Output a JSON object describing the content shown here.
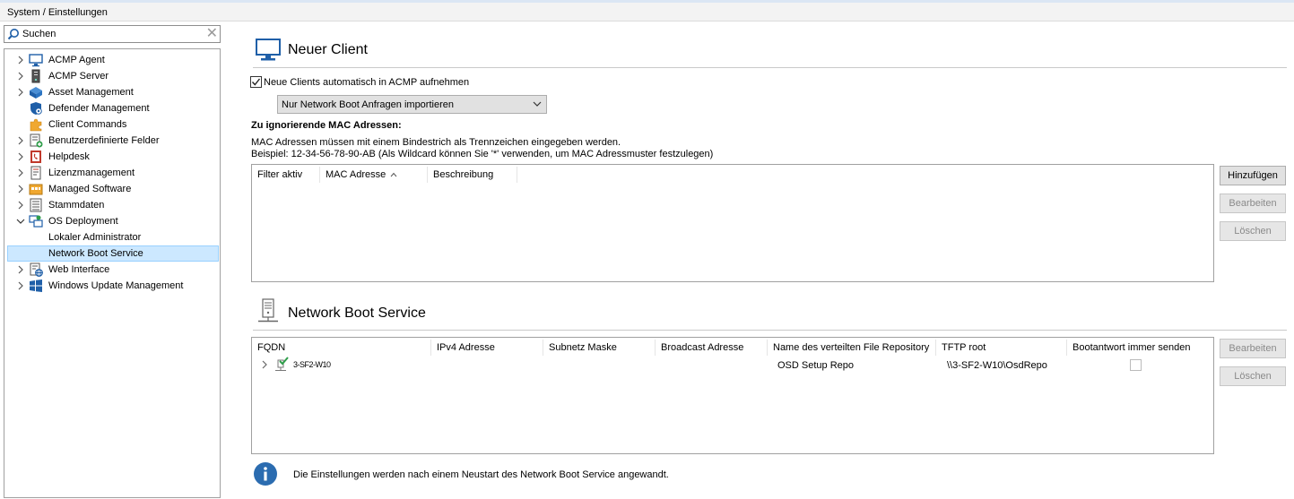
{
  "breadcrumb": "System / Einstellungen",
  "search": {
    "placeholder": "Suchen"
  },
  "tree": {
    "items": [
      {
        "label": "ACMP Agent",
        "icon": "monitor-icon"
      },
      {
        "label": "ACMP Server",
        "icon": "server-icon"
      },
      {
        "label": "Asset Management",
        "icon": "cube-icon"
      },
      {
        "label": "Defender Management",
        "icon": "shield-icon"
      },
      {
        "label": "Client Commands",
        "icon": "puzzle-icon"
      },
      {
        "label": "Benutzerdefinierte Felder",
        "icon": "form-add-icon"
      },
      {
        "label": "Helpdesk",
        "icon": "phone-book-icon"
      },
      {
        "label": "Lizenzmanagement",
        "icon": "license-icon"
      },
      {
        "label": "Managed Software",
        "icon": "software-icon"
      },
      {
        "label": "Stammdaten",
        "icon": "list-icon"
      },
      {
        "label": "OS Deployment",
        "icon": "deployment-icon"
      },
      {
        "label": "Lokaler Administrator",
        "icon": ""
      },
      {
        "label": "Network Boot Service",
        "icon": ""
      },
      {
        "label": "Web Interface",
        "icon": "web-icon"
      },
      {
        "label": "Windows Update Management",
        "icon": "windows-icon"
      }
    ]
  },
  "new_client": {
    "title": "Neuer Client",
    "auto_add_label": "Neue Clients automatisch in ACMP aufnehmen",
    "auto_add_checked": true,
    "import_mode": "Nur Network Boot Anfragen importieren",
    "mac_heading": "Zu ignorierende MAC Adressen:",
    "mac_help_1": "MAC Adressen müssen mit einem Bindestrich als Trennzeichen eingegeben werden.",
    "mac_help_2": "Beispiel: 12-34-56-78-90-AB (Als Wildcard können Sie '*' verwenden, um MAC Adressmuster festzulegen)",
    "mac_columns": [
      "Filter aktiv",
      "MAC Adresse",
      "Beschreibung"
    ],
    "buttons": {
      "add": "Hinzufügen",
      "edit": "Bearbeiten",
      "delete": "Löschen"
    }
  },
  "nbs": {
    "title": "Network Boot Service",
    "columns": [
      "FQDN",
      "IPv4 Adresse",
      "Subnetz Maske",
      "Broadcast Adresse",
      "Name des verteilten File Repository",
      "TFTP root",
      "Bootantwort immer senden"
    ],
    "rows": [
      {
        "fqdn": "3-SF2-W10",
        "ipv4": "",
        "subnet": "",
        "broadcast": "",
        "repo": "OSD Setup Repo",
        "tftp": "\\\\3-SF2-W10\\OsdRepo",
        "always_send": false
      }
    ],
    "buttons": {
      "edit": "Bearbeiten",
      "delete": "Löschen"
    },
    "info": "Die Einstellungen werden nach einem Neustart des Network Boot Service angewandt."
  },
  "colors": {
    "selected_bg": "#cce8ff",
    "info_blue": "#2b6cb0",
    "icon_blue": "#1f5fa8"
  }
}
